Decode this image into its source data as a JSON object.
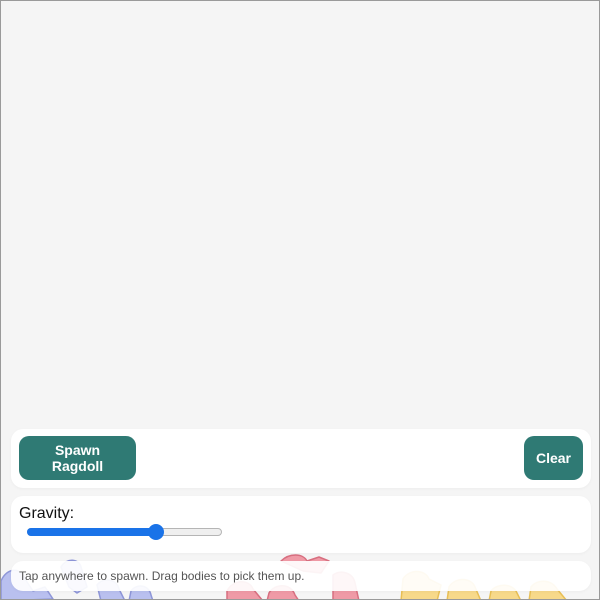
{
  "controls": {
    "spawn_label": "Spawn Ragdoll",
    "clear_label": "Clear"
  },
  "gravity": {
    "label": "Gravity:",
    "value_fraction": 0.66
  },
  "hint": {
    "text": "Tap anywhere to spawn. Drag bodies to pick them up."
  },
  "colors": {
    "button_bg": "#2f7a74",
    "slider_accent": "#1a73e8",
    "ragdoll_blue": "#b9c0ef",
    "ragdoll_red": "#ef9aa6",
    "ragdoll_yellow": "#f7d98a"
  }
}
